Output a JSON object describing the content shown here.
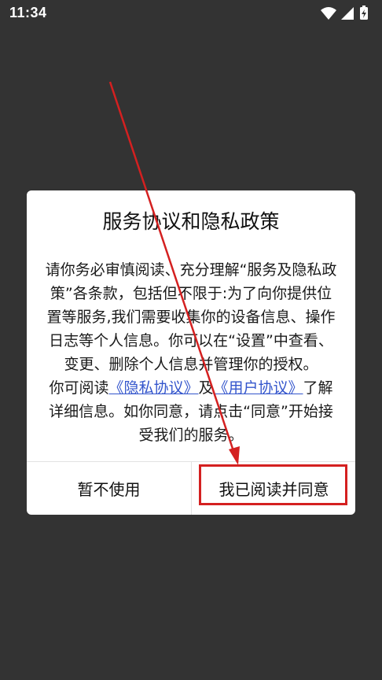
{
  "status_bar": {
    "time": "11:34",
    "icons": [
      "wifi-icon",
      "signal-icon",
      "battery-charging-icon"
    ]
  },
  "dialog": {
    "title": "服务协议和隐私政策",
    "paragraph1": "请你务必审慎阅读、充分理解“服务及隐私政策”各条款，包括但不限于:为了向你提供位置等服务,我们需要收集你的设备信息、操作日志等个人信息。你可以在“设置”中查看、变更、删除个人信息并管理你的授权。",
    "p2_prefix": "你可阅读",
    "privacy_link": "《隐私协议》",
    "p2_and": "及",
    "user_link": "《用户协议》",
    "p2_suffix": "了解详细信息。如你同意，请点击“同意”开始接受我们的服务。",
    "decline_label": "暂不使用",
    "agree_label": "我已阅读并同意"
  },
  "colors": {
    "background": "#333333",
    "link": "#3355cc",
    "annotation": "#d42020"
  }
}
